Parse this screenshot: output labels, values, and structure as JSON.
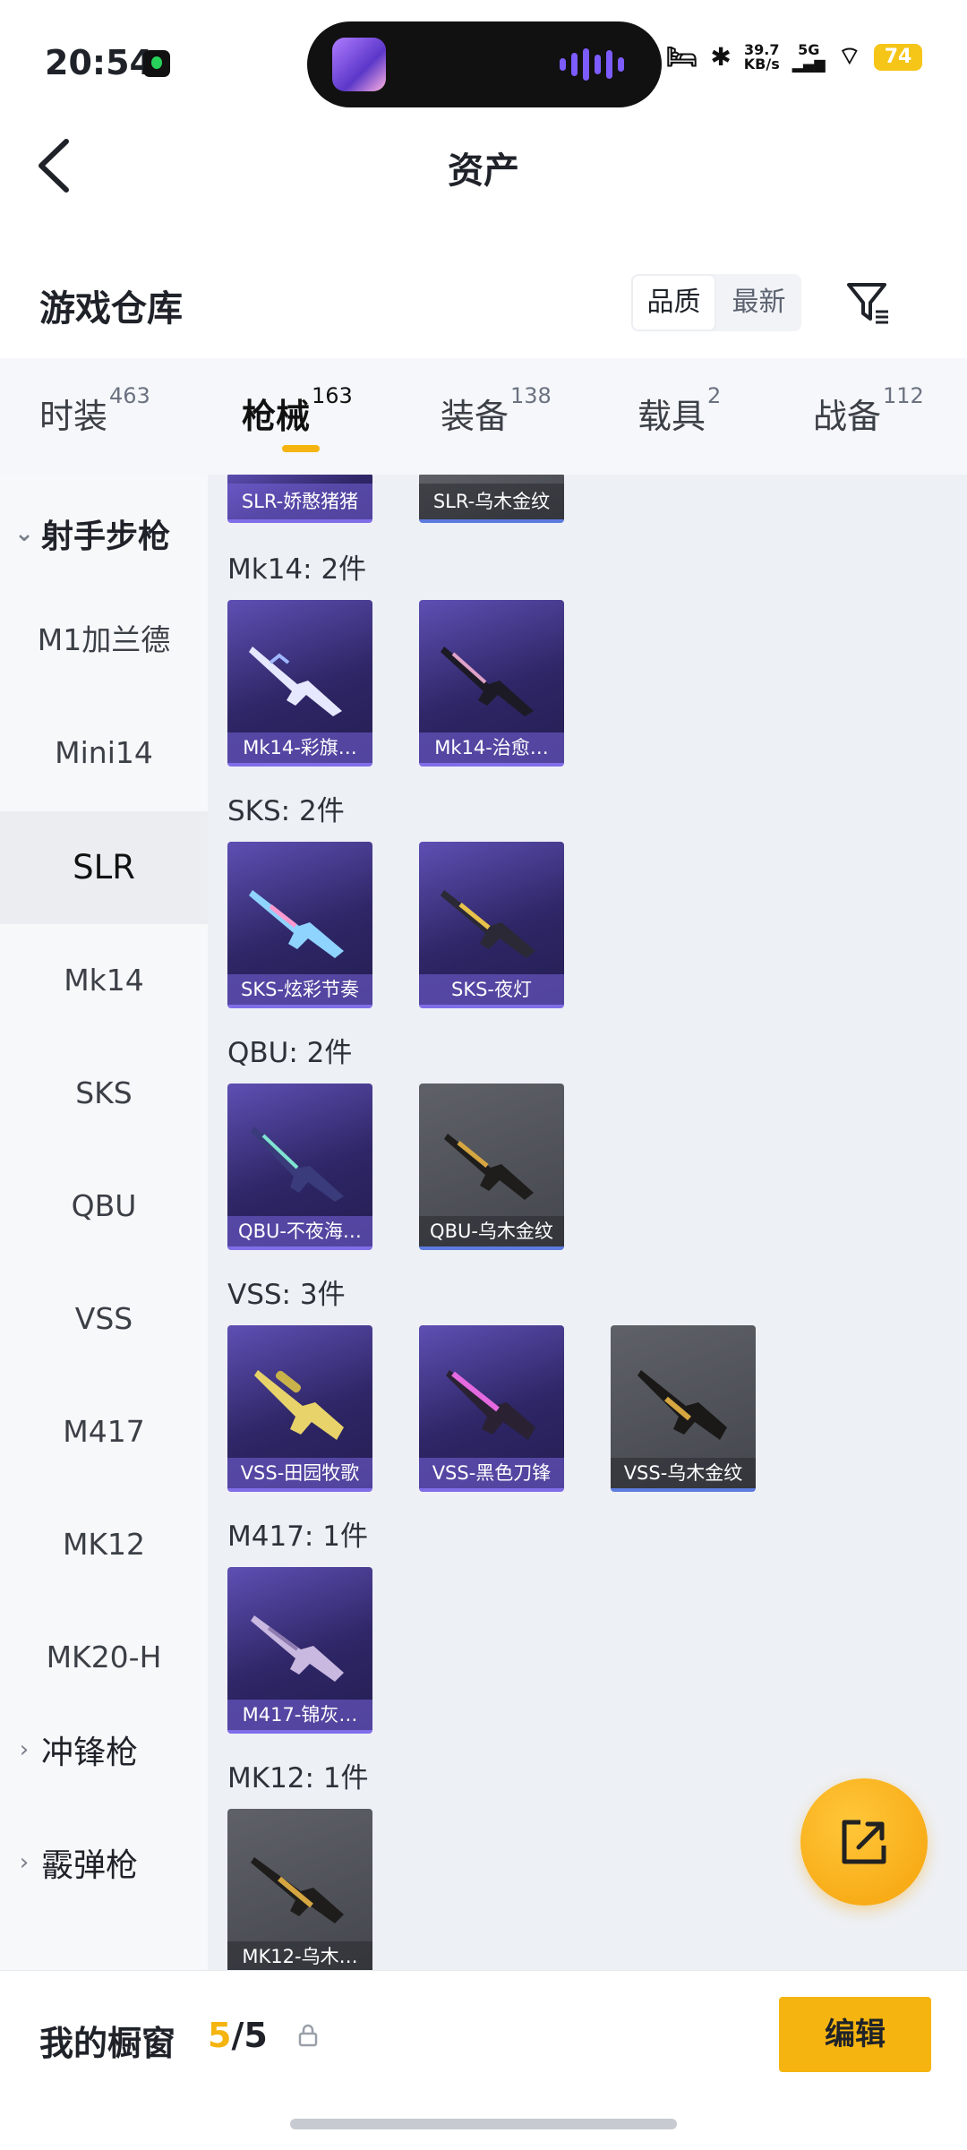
{
  "status": {
    "time": "20:54",
    "speed_value": "39.7",
    "speed_unit": "KB/s",
    "network": "5G",
    "battery": "74"
  },
  "nav": {
    "title": "资产"
  },
  "header": {
    "title": "游戏仓库",
    "sort_quality": "品质",
    "sort_latest": "最新"
  },
  "tabs": [
    {
      "label": "时装",
      "count": "463"
    },
    {
      "label": "枪械",
      "count": "163"
    },
    {
      "label": "装备",
      "count": "138"
    },
    {
      "label": "载具",
      "count": "2"
    },
    {
      "label": "战备",
      "count": "112"
    }
  ],
  "sidebar": {
    "group_open": "射手步枪",
    "items": [
      "M1加兰德",
      "Mini14",
      "SLR",
      "Mk14",
      "SKS",
      "QBU",
      "VSS",
      "M417",
      "MK12",
      "MK20-H"
    ],
    "group_smg": "冲锋枪",
    "group_shotgun": "霰弹枪"
  },
  "grid": {
    "top_partial": [
      "SLR-娇憨猪猪",
      "SLR-乌木金纹"
    ],
    "groups": [
      {
        "label": "Mk14: 2件",
        "items": [
          "Mk14-彩旗…",
          "Mk14-治愈…"
        ]
      },
      {
        "label": "SKS: 2件",
        "items": [
          "SKS-炫彩节奏",
          "SKS-夜灯"
        ]
      },
      {
        "label": "QBU: 2件",
        "items": [
          "QBU-不夜海…",
          "QBU-乌木金纹"
        ]
      },
      {
        "label": "VSS: 3件",
        "items": [
          "VSS-田园牧歌",
          "VSS-黑色刀锋",
          "VSS-乌木金纹"
        ]
      },
      {
        "label": "M417: 1件",
        "items": [
          "M417-锦灰…"
        ]
      },
      {
        "label": "MK12: 1件",
        "items": [
          "MK12-乌木…"
        ]
      }
    ]
  },
  "bottom": {
    "label": "我的橱窗",
    "count_current": "5",
    "count_sep": "/",
    "count_total": "5",
    "edit": "编辑"
  },
  "colors": {
    "accent": "#f5b40f",
    "card_purple": "#2e2666",
    "card_grey": "#4a4c53"
  }
}
